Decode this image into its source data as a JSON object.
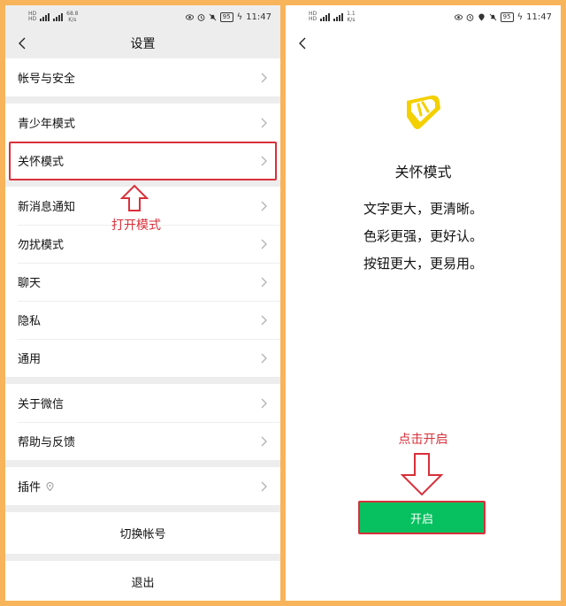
{
  "left": {
    "status": {
      "net_speed_value": "68.8",
      "net_speed_unit": "K/s",
      "battery": "95",
      "time": "11:47"
    },
    "nav": {
      "title": "设置"
    },
    "groups": [
      {
        "items": [
          "帐号与安全"
        ]
      },
      {
        "items": [
          "青少年模式",
          "关怀模式"
        ]
      },
      {
        "items": [
          "新消息通知",
          "勿扰模式",
          "聊天",
          "隐私",
          "通用"
        ]
      },
      {
        "items": [
          "关于微信",
          "帮助与反馈"
        ]
      },
      {
        "items": [
          "插件"
        ]
      }
    ],
    "switch_account": "切换帐号",
    "logout": "退出",
    "annotation": "打开模式"
  },
  "right": {
    "status": {
      "net_speed_value": "1.1",
      "net_speed_unit": "K/s",
      "battery": "95",
      "time": "11:47"
    },
    "care": {
      "title": "关怀模式",
      "lines": [
        "文字更大，更清晰。",
        "色彩更强，更好认。",
        "按钮更大，更易用。"
      ]
    },
    "annotation": "点击开启",
    "enable_button": "开启"
  },
  "colors": {
    "accent_green": "#07c160",
    "annotation_red": "#d9303a",
    "icon_yellow": "#f4d000",
    "frame_orange": "#f7b45a"
  }
}
